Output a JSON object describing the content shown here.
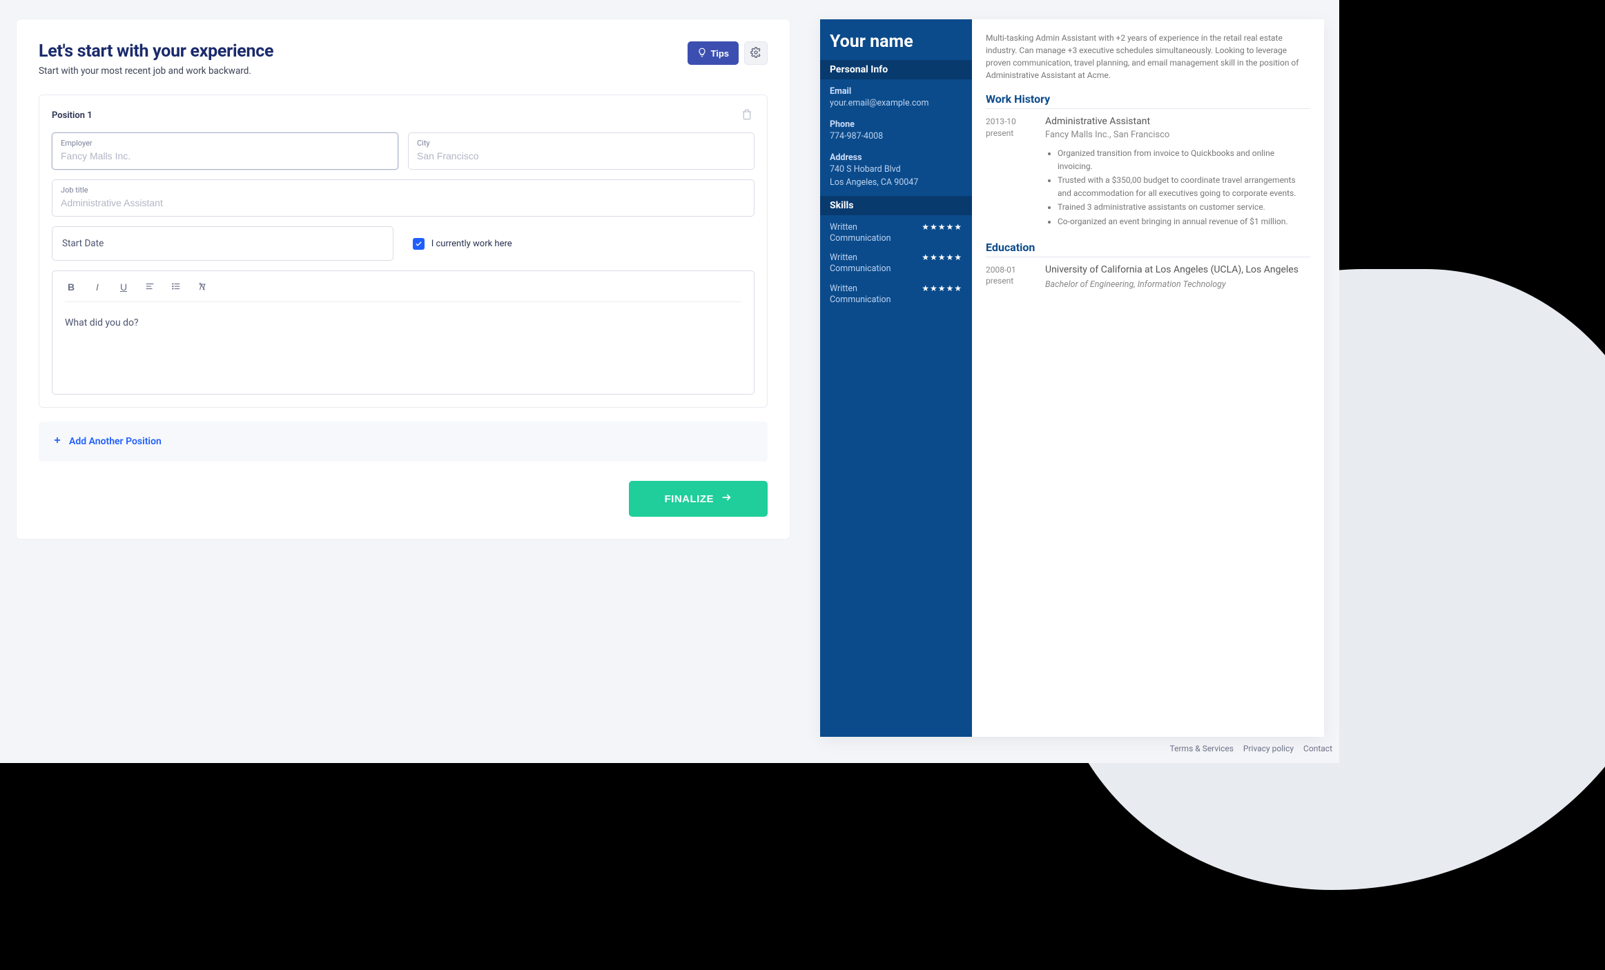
{
  "form": {
    "title": "Let's start with your experience",
    "subtitle": "Start with your most recent job and work backward.",
    "tips_label": "Tips",
    "position_label": "Position 1",
    "employer": {
      "label": "Employer",
      "placeholder": "Fancy Malls Inc."
    },
    "city": {
      "label": "City",
      "placeholder": "San Francisco"
    },
    "job_title": {
      "label": "Job title",
      "placeholder": "Administrative Assistant"
    },
    "start_date_label": "Start Date",
    "currently_work_label": "I currently work here",
    "editor_placeholder": "What did you do?",
    "add_position_label": "Add Another Position",
    "finalize_label": "FINALIZE"
  },
  "preview": {
    "name": "Your name",
    "sections": {
      "personal": "Personal Info",
      "skills": "Skills",
      "work": "Work History",
      "education": "Education"
    },
    "info": {
      "email_label": "Email",
      "email": "your.email@example.com",
      "phone_label": "Phone",
      "phone": "774-987-4008",
      "address_label": "Address",
      "address_line1": "740 S Hobard Blvd",
      "address_line2": "Los Angeles, CA 90047"
    },
    "skills": [
      {
        "name": "Written Communication",
        "stars": "★★★★★"
      },
      {
        "name": "Written Communication",
        "stars": "★★★★★"
      },
      {
        "name": "Written Communication",
        "stars": "★★★★★"
      }
    ],
    "summary": "Multi-tasking Admin Assistant with +2 years of experience in the retail real estate industry. Can manage +3 executive schedules simultaneously. Looking to leverage proven communication, travel planning, and email management skill in the position of Administrative Assistant at Acme.",
    "work": {
      "date1": "2013-10",
      "date2": "present",
      "title": "Administrative Assistant",
      "company": "Fancy Malls Inc., San Francisco",
      "bullets": [
        "Organized transition from invoice to Quickbooks and online invoicing.",
        "Trusted with a $350,00 budget to coordinate travel arrangements and accommodation for all executives going to corporate events.",
        "Trained 3 administrative assistants on customer service.",
        "Co-organized an event bringing in annual revenue of $1 million."
      ]
    },
    "education": {
      "date1": "2008-01",
      "date2": "present",
      "school": "University of California at Los Angeles (UCLA), Los Angeles",
      "degree": "Bachelor of Engineering, Information Technology"
    }
  },
  "footer": {
    "terms": "Terms & Services",
    "privacy": "Privacy policy",
    "contact": "Contact"
  }
}
